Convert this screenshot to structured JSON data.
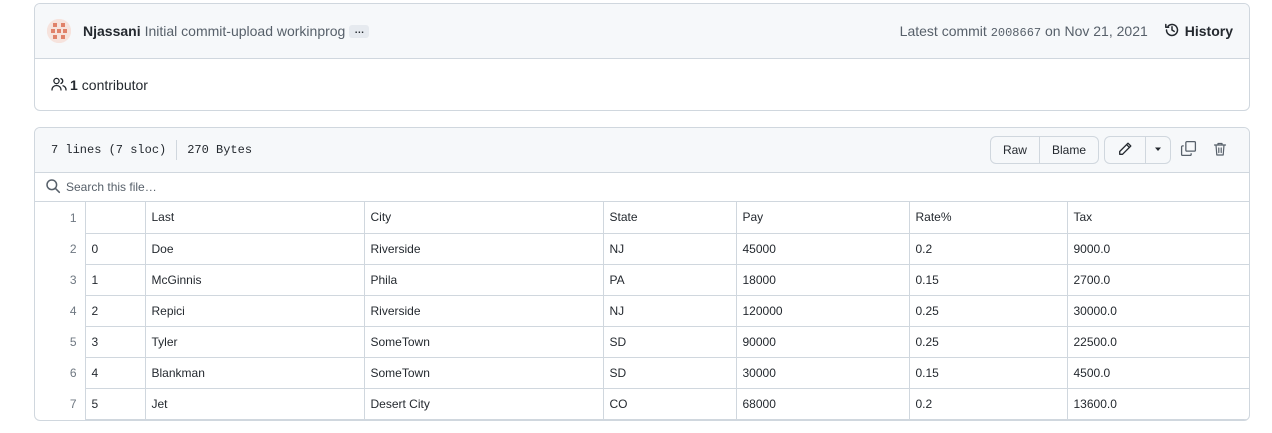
{
  "commit": {
    "author": "Njassani",
    "message": "Initial commit-upload workinprog",
    "ellipsis": "…",
    "latest_label": "Latest commit",
    "sha": "2008667",
    "date_text": "on Nov 21, 2021",
    "history_label": "History"
  },
  "contributors": {
    "count": "1",
    "label": "contributor"
  },
  "file": {
    "lines": "7 lines (7 sloc)",
    "size": "270 Bytes",
    "raw_label": "Raw",
    "blame_label": "Blame",
    "search_placeholder": "Search this file…"
  },
  "table": {
    "line_numbers": [
      "1",
      "2",
      "3",
      "4",
      "5",
      "6",
      "7"
    ],
    "headers": [
      "",
      "Last",
      "City",
      "State",
      "Pay",
      "Rate%",
      "Tax"
    ],
    "rows": [
      [
        "0",
        "Doe",
        "Riverside",
        "NJ",
        "45000",
        "0.2",
        "9000.0"
      ],
      [
        "1",
        "McGinnis",
        "Phila",
        "PA",
        "18000",
        "0.15",
        "2700.0"
      ],
      [
        "2",
        "Repici",
        "Riverside",
        "NJ",
        "120000",
        "0.25",
        "30000.0"
      ],
      [
        "3",
        "Tyler",
        "SomeTown",
        "SD",
        "90000",
        "0.25",
        "22500.0"
      ],
      [
        "4",
        "Blankman",
        "SomeTown",
        "SD",
        "30000",
        "0.15",
        "4500.0"
      ],
      [
        "5",
        "Jet",
        "Desert City",
        "CO",
        "68000",
        "0.2",
        "13600.0"
      ]
    ]
  },
  "colors": {
    "border": "#d0d7de",
    "header_bg": "#f6f8fa",
    "text": "#24292f",
    "muted": "#57606a"
  }
}
